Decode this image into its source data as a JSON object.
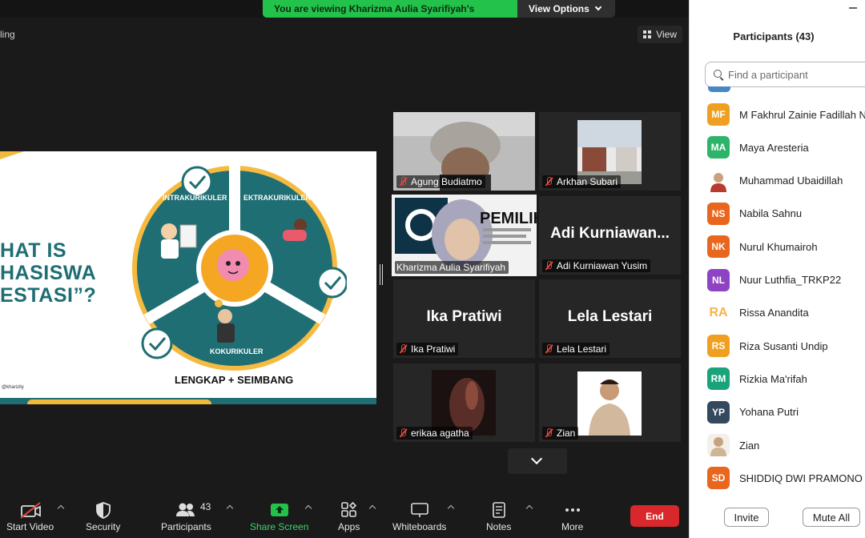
{
  "share_banner": {
    "message": "You are viewing Kharizma Aulia Syarifiyah's screen",
    "options_label": "View Options"
  },
  "stage": {
    "recording_label_partial": "ling",
    "view_label": "View"
  },
  "slide": {
    "question_lines": [
      "HAT IS",
      "HASISWA",
      "ESTASI”?"
    ],
    "labels": {
      "intra": "INTRAKURIKULER",
      "ekstra": "EKTRAKURIKULER",
      "ko": "KOKURIKULER"
    },
    "footer": "LENGKAP + SEIMBANG",
    "handle": "@kharizily"
  },
  "gallery": {
    "tiles": [
      {
        "name": "Agung Budiatmo",
        "video": true
      },
      {
        "name": "Arkhan Subari",
        "video": true
      },
      {
        "name": "Kharizma Aulia Syarifiyah",
        "video": true,
        "active": true
      },
      {
        "name": "Adi Kurniawan Yusim",
        "big_name": "Adi  Kurniawan...",
        "video": false
      },
      {
        "name": "Ika Pratiwi",
        "big_name": "Ika Pratiwi",
        "video": false
      },
      {
        "name": "Lela Lestari",
        "big_name": "Lela Lestari",
        "video": false
      },
      {
        "name": "erikaa agatha",
        "video": true
      },
      {
        "name": "Zian",
        "video": true
      }
    ],
    "kharizma_slide_text": "PEMILIH"
  },
  "toolbar": {
    "start_video": "Start Video",
    "security": "Security",
    "participants": "Participants",
    "participants_count": "43",
    "share_screen": "Share Screen",
    "apps": "Apps",
    "whiteboards": "Whiteboards",
    "notes": "Notes",
    "more": "More",
    "end": "End"
  },
  "panel": {
    "title": "Participants (43)",
    "search_placeholder": "Find a participant",
    "participants": [
      {
        "initials": "MF",
        "name": "M Fakhrul Zainie Fadillah N",
        "color": "#f0a020"
      },
      {
        "initials": "MA",
        "name": "Maya Aresteria",
        "color": "#2eb36a"
      },
      {
        "initials": "",
        "name": "Muhammad Ubaidillah",
        "color": "#c0392b",
        "photo": true
      },
      {
        "initials": "NS",
        "name": "Nabila Sahnu",
        "color": "#e8661e"
      },
      {
        "initials": "NK",
        "name": "Nurul Khumairoh",
        "color": "#e8661e"
      },
      {
        "initials": "NL",
        "name": "Nuur Luthfia_TRKP22",
        "color": "#8e44c2"
      },
      {
        "initials": "RA",
        "name": "Rissa Anandita",
        "color": "#ffffff",
        "light": true
      },
      {
        "initials": "RS",
        "name": "Riza Susanti Undip",
        "color": "#f0a020"
      },
      {
        "initials": "RM",
        "name": "Rizkia Ma'rifah",
        "color": "#1aa37a"
      },
      {
        "initials": "YP",
        "name": "Yohana Putri",
        "color": "#34495e"
      },
      {
        "initials": "",
        "name": "Zian",
        "color": "#e8e0d6",
        "photo": true
      },
      {
        "initials": "SD",
        "name": "SHIDDIQ DWI PRAMONO J",
        "color": "#e8661e"
      }
    ],
    "invite": "Invite",
    "mute_all": "Mute All"
  }
}
